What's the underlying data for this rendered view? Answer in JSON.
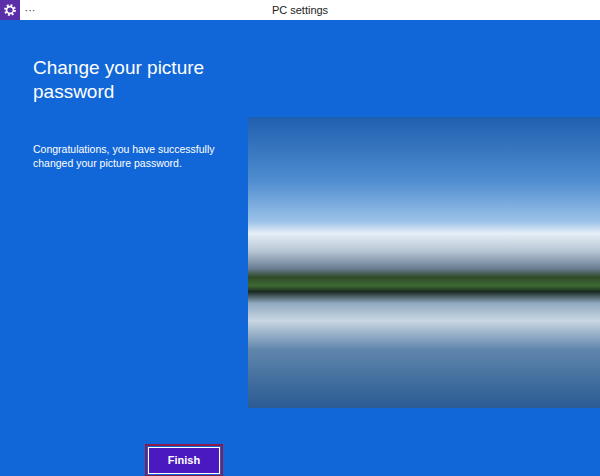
{
  "window": {
    "title": "PC settings",
    "menu": "···"
  },
  "page": {
    "heading": "Change your picture password",
    "message": "Congratulations, you have successfully changed your picture password."
  },
  "buttons": [
    {
      "label": "Finish",
      "focused": true
    }
  ]
}
